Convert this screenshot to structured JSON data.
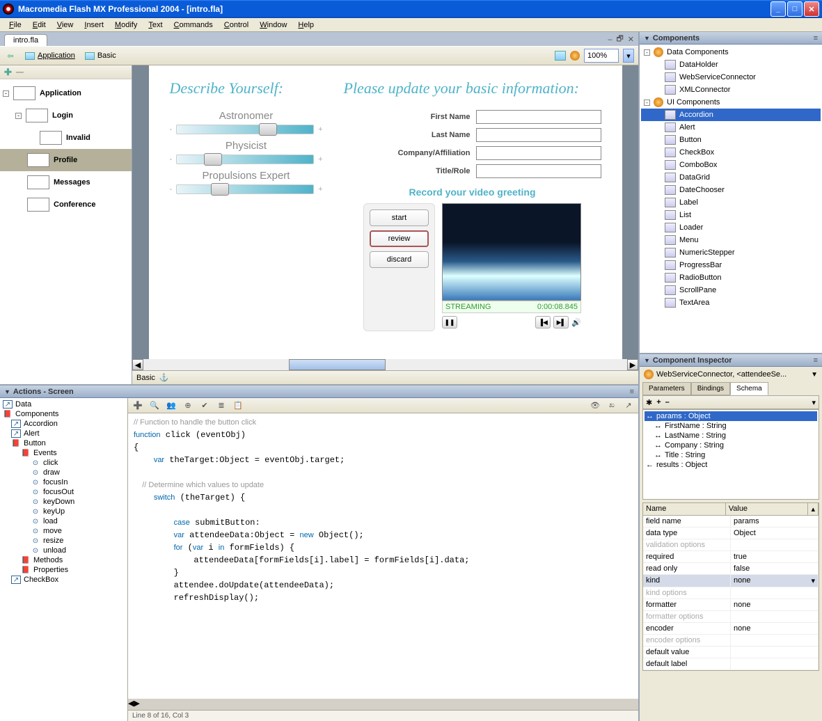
{
  "window": {
    "title": "Macromedia Flash MX Professional 2004  -  [intro.fla]"
  },
  "menu": [
    "File",
    "Edit",
    "View",
    "Insert",
    "Modify",
    "Text",
    "Commands",
    "Control",
    "Window",
    "Help"
  ],
  "doc": {
    "tab": "intro.fla",
    "zoom": "100%"
  },
  "breadcrumbs": [
    {
      "label": "Application",
      "active": true
    },
    {
      "label": "Basic",
      "active": false
    }
  ],
  "screenTree": [
    {
      "label": "Application",
      "indent": 0,
      "sel": false,
      "toggle": "-"
    },
    {
      "label": "Login",
      "indent": 1,
      "sel": false,
      "toggle": "-"
    },
    {
      "label": "Invalid",
      "indent": 2,
      "sel": false
    },
    {
      "label": "Profile",
      "indent": 1,
      "sel": true
    },
    {
      "label": "Messages",
      "indent": 1,
      "sel": false
    },
    {
      "label": "Conference",
      "indent": 1,
      "sel": false
    }
  ],
  "stage": {
    "h1": "Describe Yourself:",
    "h2": "Please update your basic information:",
    "sliders": [
      {
        "label": "Astronomer",
        "pos": 60
      },
      {
        "label": "Physicist",
        "pos": 20
      },
      {
        "label": "Propulsions Expert",
        "pos": 25
      }
    ],
    "fields": [
      {
        "label": "First Name"
      },
      {
        "label": "Last Name"
      },
      {
        "label": "Company/Affiliation"
      },
      {
        "label": "Title/Role"
      }
    ],
    "video": {
      "title": "Record your video greeting",
      "buttons": [
        "start",
        "review",
        "discard"
      ],
      "status": "STREAMING",
      "time": "0:00:08.845"
    },
    "bottomTab": "Basic"
  },
  "actions": {
    "title": "Actions - Screen",
    "tree": [
      {
        "l": "Data",
        "i": 0,
        "ic": "arrow"
      },
      {
        "l": "Components",
        "i": 0,
        "ic": "book"
      },
      {
        "l": "Accordion",
        "i": 1,
        "ic": "arrow"
      },
      {
        "l": "Alert",
        "i": 1,
        "ic": "arrow"
      },
      {
        "l": "Button",
        "i": 1,
        "ic": "book"
      },
      {
        "l": "Events",
        "i": 2,
        "ic": "book"
      },
      {
        "l": "click",
        "i": 3,
        "ic": "circ"
      },
      {
        "l": "draw",
        "i": 3,
        "ic": "circ"
      },
      {
        "l": "focusIn",
        "i": 3,
        "ic": "circ"
      },
      {
        "l": "focusOut",
        "i": 3,
        "ic": "circ"
      },
      {
        "l": "keyDown",
        "i": 3,
        "ic": "circ"
      },
      {
        "l": "keyUp",
        "i": 3,
        "ic": "circ"
      },
      {
        "l": "load",
        "i": 3,
        "ic": "circ"
      },
      {
        "l": "move",
        "i": 3,
        "ic": "circ"
      },
      {
        "l": "resize",
        "i": 3,
        "ic": "circ"
      },
      {
        "l": "unload",
        "i": 3,
        "ic": "circ"
      },
      {
        "l": "Methods",
        "i": 2,
        "ic": "book"
      },
      {
        "l": "Properties",
        "i": 2,
        "ic": "book"
      },
      {
        "l": "CheckBox",
        "i": 1,
        "ic": "arrow"
      }
    ],
    "status": "Line 8 of 16, Col 3",
    "code": "// Function to handle the button click\nfunction click (eventObj)\n{\n    var theTarget:Object = eventObj.target;\n\n    // Determine which values to update\n    switch (theTarget) {\n\n        case submitButton:\n        var attendeeData:Object = new Object();\n        for (var i in formFields) {\n            attendeeData[formFields[i].label] = formFields[i].data;\n        }\n        attendee.doUpdate(attendeeData);\n        refreshDisplay();"
  },
  "components": {
    "title": "Components",
    "tree": [
      {
        "l": "Data Components",
        "i": 0,
        "t": "-",
        "ic": "folder"
      },
      {
        "l": "DataHolder",
        "i": 1,
        "ic": "dh"
      },
      {
        "l": "WebServiceConnector",
        "i": 1,
        "ic": "ws"
      },
      {
        "l": "XMLConnector",
        "i": 1,
        "ic": "xml"
      },
      {
        "l": "UI Components",
        "i": 0,
        "t": "-",
        "ic": "folder"
      },
      {
        "l": "Accordion",
        "i": 1,
        "sel": true,
        "ic": "acc"
      },
      {
        "l": "Alert",
        "i": 1,
        "ic": "al"
      },
      {
        "l": "Button",
        "i": 1,
        "ic": "bt"
      },
      {
        "l": "CheckBox",
        "i": 1,
        "ic": "cb"
      },
      {
        "l": "ComboBox",
        "i": 1,
        "ic": "cmb"
      },
      {
        "l": "DataGrid",
        "i": 1,
        "ic": "dg"
      },
      {
        "l": "DateChooser",
        "i": 1,
        "ic": "dc"
      },
      {
        "l": "Label",
        "i": 1,
        "ic": "lb"
      },
      {
        "l": "List",
        "i": 1,
        "ic": "ls"
      },
      {
        "l": "Loader",
        "i": 1,
        "ic": "ld"
      },
      {
        "l": "Menu",
        "i": 1,
        "ic": "mn"
      },
      {
        "l": "NumericStepper",
        "i": 1,
        "ic": "ns"
      },
      {
        "l": "ProgressBar",
        "i": 1,
        "ic": "pb"
      },
      {
        "l": "RadioButton",
        "i": 1,
        "ic": "rb"
      },
      {
        "l": "ScrollPane",
        "i": 1,
        "ic": "sp"
      },
      {
        "l": "TextArea",
        "i": 1,
        "ic": "ta"
      }
    ]
  },
  "inspector": {
    "title": "Component Inspector",
    "instance": "WebServiceConnector, <attendeeSe...",
    "tabs": [
      "Parameters",
      "Bindings",
      "Schema"
    ],
    "activeTab": 2,
    "schema": [
      {
        "l": "params : Object",
        "sel": true,
        "i": 0,
        "a": "↔"
      },
      {
        "l": "FirstName : String",
        "i": 1,
        "a": "↔"
      },
      {
        "l": "LastName : String",
        "i": 1,
        "a": "↔"
      },
      {
        "l": "Company : String",
        "i": 1,
        "a": "↔"
      },
      {
        "l": "Title : String",
        "i": 1,
        "a": "↔"
      },
      {
        "l": "results : Object",
        "i": 0,
        "a": "←"
      }
    ],
    "props": {
      "headers": [
        "Name",
        "Value"
      ],
      "rows": [
        {
          "n": "field name",
          "v": "params"
        },
        {
          "n": "data type",
          "v": "Object"
        },
        {
          "n": "validation options",
          "v": "",
          "dis": true
        },
        {
          "n": "required",
          "v": "true"
        },
        {
          "n": "read only",
          "v": "false"
        },
        {
          "n": "kind",
          "v": "none",
          "sel": true,
          "dd": true
        },
        {
          "n": "kind options",
          "v": "",
          "dis": true
        },
        {
          "n": "formatter",
          "v": "none"
        },
        {
          "n": "formatter options",
          "v": "",
          "dis": true
        },
        {
          "n": "encoder",
          "v": "none"
        },
        {
          "n": "encoder options",
          "v": "",
          "dis": true
        },
        {
          "n": "default value",
          "v": ""
        },
        {
          "n": "default label",
          "v": ""
        }
      ]
    }
  }
}
